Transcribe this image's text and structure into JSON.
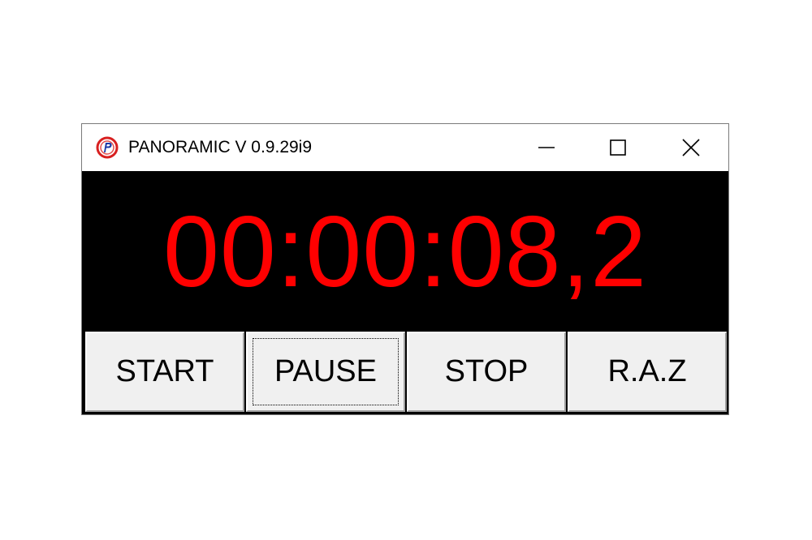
{
  "window": {
    "title": "PANORAMIC V 0.9.29i9",
    "icon": "panoramic-logo-icon",
    "controls": {
      "minimize_icon": "minimize-icon",
      "maximize_icon": "maximize-icon",
      "close_icon": "close-icon"
    }
  },
  "display": {
    "time": "00:00:08,2",
    "color": "#ff0000",
    "background": "#000000"
  },
  "buttons": [
    {
      "label": "START"
    },
    {
      "label": "PAUSE",
      "focused": true
    },
    {
      "label": "STOP"
    },
    {
      "label": "R.A.Z"
    }
  ]
}
